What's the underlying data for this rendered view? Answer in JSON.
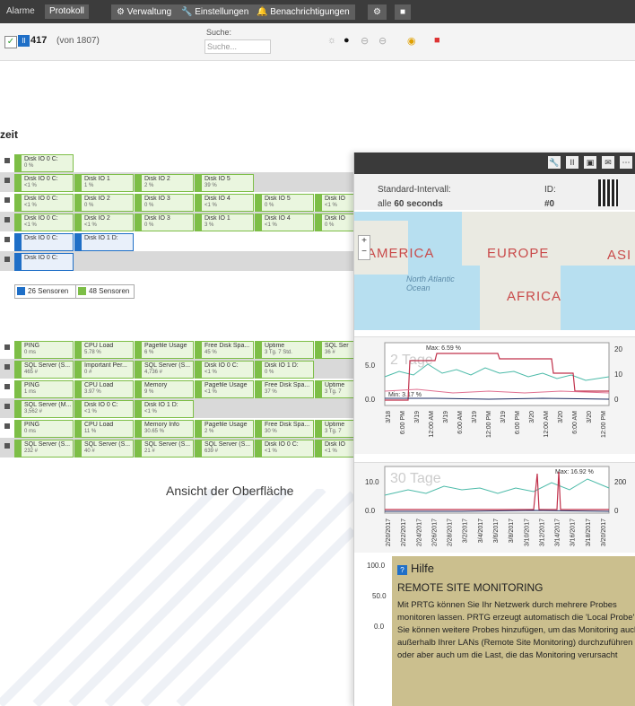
{
  "topbar": {
    "tab_alarme": "Alarme",
    "tab_protokoll": "Protokoll",
    "btn_verwaltung": "Verwaltung",
    "btn_einstellungen": "Einstellungen",
    "btn_benachrichtigungen": "Benachrichtigungen"
  },
  "filter": {
    "count": "417",
    "count_sub": "(von 1807)",
    "search_label": "Suche:",
    "search_placeholder": "Suche..."
  },
  "heading": "zeit",
  "sensor_rows": [
    [
      {
        "name": "Disk IO 0 C:",
        "value": "0 %"
      }
    ],
    [
      {
        "name": "Disk IO 0 C:",
        "value": "<1 %"
      },
      {
        "name": "Disk IO 1",
        "value": "1 %"
      },
      {
        "name": "Disk IO 2",
        "value": "2 %"
      },
      {
        "name": "Disk IO 5",
        "value": "39 %"
      }
    ],
    [
      {
        "name": "Disk IO 0 C:",
        "value": "<1 %"
      },
      {
        "name": "Disk IO 2",
        "value": "0 %"
      },
      {
        "name": "Disk IO 3",
        "value": "0 %"
      },
      {
        "name": "Disk IO 4",
        "value": "<1 %"
      },
      {
        "name": "Disk IO 5",
        "value": "0 %"
      },
      {
        "name": "Disk IO",
        "value": "<1 %"
      }
    ],
    [
      {
        "name": "Disk IO 0 C:",
        "value": "<1 %"
      },
      {
        "name": "Disk IO 2",
        "value": "<1 %"
      },
      {
        "name": "Disk IO 3",
        "value": "0 %"
      },
      {
        "name": "Disk IO 1",
        "value": "3 %"
      },
      {
        "name": "Disk IO 4",
        "value": "<1 %"
      },
      {
        "name": "Disk IO",
        "value": "0 %"
      }
    ],
    [
      {
        "name": "Disk IO 0 C:",
        "value": ""
      },
      {
        "name": "Disk IO 1 D:",
        "value": ""
      }
    ],
    [
      {
        "name": "Disk IO 0 C:",
        "value": ""
      }
    ]
  ],
  "pills": {
    "blue": "26 Sensoren",
    "green": "48 Sensoren"
  },
  "sensor_rows2": [
    [
      {
        "name": "PING",
        "value": "0 ms"
      },
      {
        "name": "CPU Load",
        "value": "5.78 %"
      },
      {
        "name": "Pagefile Usage",
        "value": "6 %"
      },
      {
        "name": "Free Disk Spa...",
        "value": "45 %"
      },
      {
        "name": "Uptime",
        "value": "3 Tg. 7 Std."
      },
      {
        "name": "SQL Ser",
        "value": "36 #"
      }
    ],
    [
      {
        "name": "SQL Server (S...",
        "value": "465 #"
      },
      {
        "name": "Important Per...",
        "value": "0 #"
      },
      {
        "name": "SQL Server (S...",
        "value": "4,736 #"
      },
      {
        "name": "Disk IO 0 C:",
        "value": "<1 %"
      },
      {
        "name": "Disk IO 1 D:",
        "value": "0 %"
      }
    ],
    [
      {
        "name": "PING",
        "value": "1 ms"
      },
      {
        "name": "CPU Load",
        "value": "3.97 %"
      },
      {
        "name": "Memory",
        "value": "9 %"
      },
      {
        "name": "Pagefile Usage",
        "value": "<1 %"
      },
      {
        "name": "Free Disk Spa...",
        "value": "37 %"
      },
      {
        "name": "Uptime",
        "value": "3 Tg. 7"
      }
    ],
    [
      {
        "name": "SQL Server (M...",
        "value": "3,562 #"
      },
      {
        "name": "Disk IO 0 C:",
        "value": "<1 %"
      },
      {
        "name": "Disk IO 1 D:",
        "value": "<1 %"
      }
    ],
    [
      {
        "name": "PING",
        "value": "0 ms"
      },
      {
        "name": "CPU Load",
        "value": "11 %"
      },
      {
        "name": "Memory Info",
        "value": "30.65 %"
      },
      {
        "name": "Pagefile Usage",
        "value": "2 %"
      },
      {
        "name": "Free Disk Spa...",
        "value": "30 %"
      },
      {
        "name": "Uptime",
        "value": "3 Tg. 7"
      }
    ],
    [
      {
        "name": "SQL Server (S...",
        "value": "232 #"
      },
      {
        "name": "SQL Server (S...",
        "value": "40 #"
      },
      {
        "name": "SQL Server (S...",
        "value": "21 #"
      },
      {
        "name": "SQL Server (S...",
        "value": "639 #"
      },
      {
        "name": "Disk IO 0 C:",
        "value": "<1 %"
      },
      {
        "name": "Disk IO",
        "value": "<1 %"
      }
    ]
  ],
  "caption": "Ansicht der Oberfläche",
  "panel": {
    "interval_label": "Standard-Intervall:",
    "interval_prefix": "alle ",
    "interval_value": "60 seconds",
    "id_label": "ID:",
    "id_value": "#0",
    "map_labels": [
      "AMERICA",
      "EUROPE",
      "ASI",
      "AFRICA"
    ],
    "map_ocean": "North Atlantic Ocean",
    "graph1": {
      "title": "2 Tage",
      "max": "Max: 6.59 %",
      "min": "Min: 3.17 %",
      "y_left": [
        "5.0",
        "0.0"
      ],
      "y_right": [
        "20",
        "10",
        "0"
      ],
      "x": [
        "3/18",
        "6:00 PM",
        "3/19",
        "12:00 AM",
        "3/19",
        "6:00 AM",
        "3/19",
        "12:00 PM",
        "3/19",
        "6:00 PM",
        "3/20",
        "12:00 AM",
        "3/20",
        "6:00 AM",
        "3/20",
        "12:00 PM"
      ]
    },
    "graph2": {
      "title": "30 Tage",
      "max": "Max: 16.92 %",
      "y_left": [
        "10.0",
        "0.0"
      ],
      "y_right": [
        "200",
        "0"
      ],
      "x": [
        "2/20/2017",
        "2/22/2017",
        "2/24/2017",
        "2/26/2017",
        "2/28/2017",
        "3/2/2017",
        "3/4/2017",
        "3/6/2017",
        "3/8/2017",
        "3/10/2017",
        "3/12/2017",
        "3/14/2017",
        "3/16/2017",
        "3/18/2017",
        "3/20/2017"
      ]
    },
    "graph3": {
      "y_left": [
        "100.0",
        "50.0",
        "0.0"
      ]
    },
    "help": {
      "title": "Hilfe",
      "heading": "REMOTE SITE MONITORING",
      "text": "Mit PRTG können Sie Ihr Netzwerk durch mehrere Probes monitoren lassen. PRTG erzeugt automatisch die 'Local Probe'. Sie können weitere Probes hinzufügen, um das Monitoring auch außerhalb Ihrer LANs (Remote Site Monitoring) durchzuführen oder aber auch um die Last, die das Monitoring verursacht"
    }
  }
}
